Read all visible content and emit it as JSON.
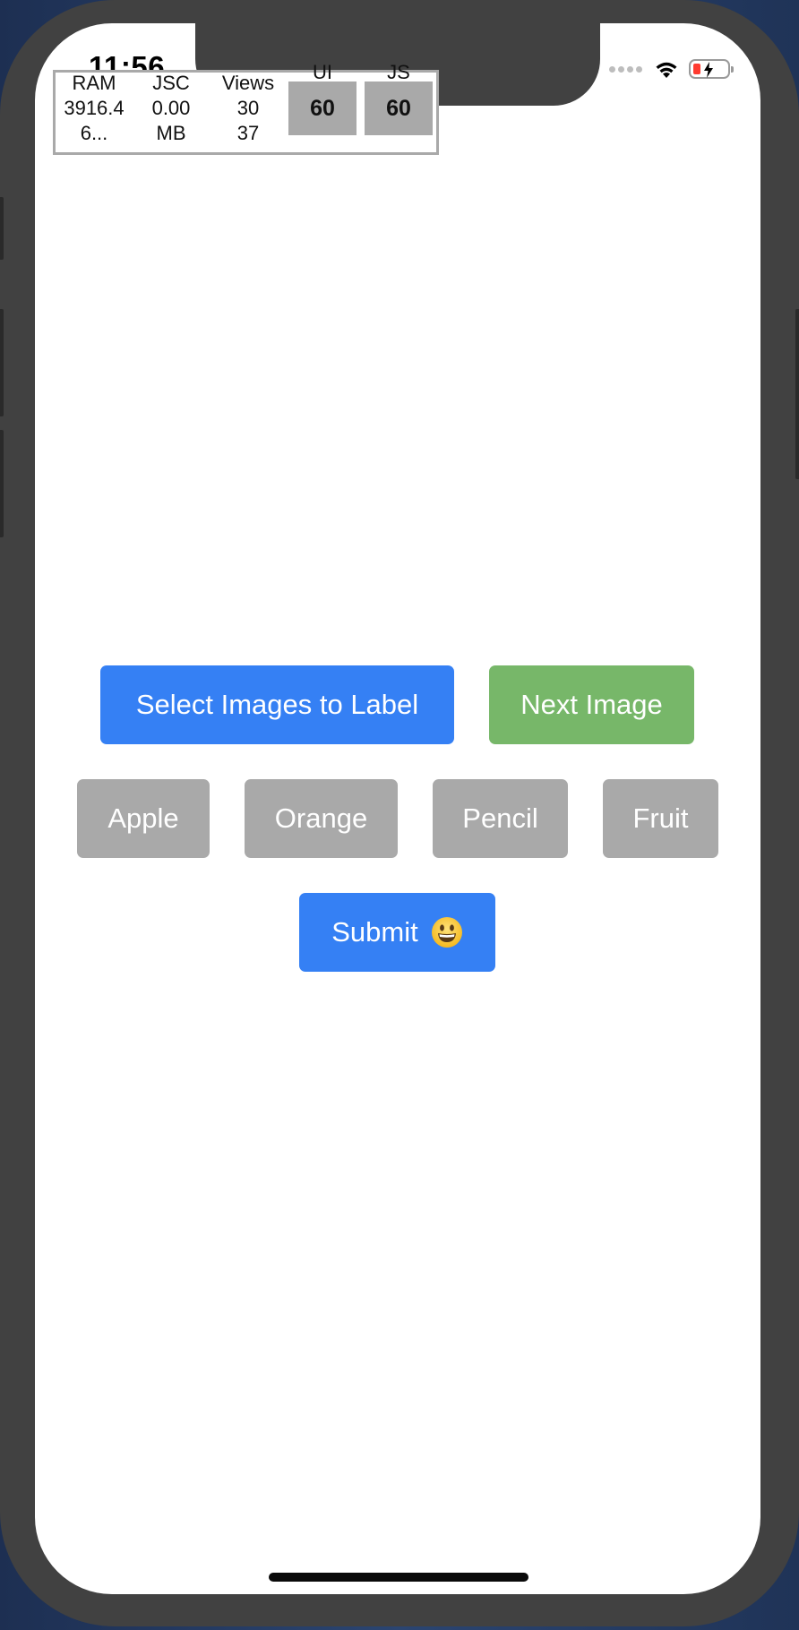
{
  "status_bar": {
    "time": "11:56"
  },
  "perf_monitor": {
    "columns": [
      {
        "label": "RAM",
        "value": "3916.4",
        "sub": "6..."
      },
      {
        "label": "JSC",
        "value": "0.00",
        "sub": "MB"
      },
      {
        "label": "Views",
        "value": "30",
        "sub": "37"
      }
    ],
    "ui": {
      "label": "UI",
      "value": "60"
    },
    "js": {
      "label": "JS",
      "value": "60"
    }
  },
  "actions": {
    "select_label": "Select Images to Label",
    "next_label": "Next Image"
  },
  "labels": [
    "Apple",
    "Orange",
    "Pencil",
    "Fruit"
  ],
  "submit": {
    "label": "Submit"
  },
  "colors": {
    "primary": "#3580f4",
    "success": "#77b769",
    "neutral": "#a9a9a9"
  }
}
